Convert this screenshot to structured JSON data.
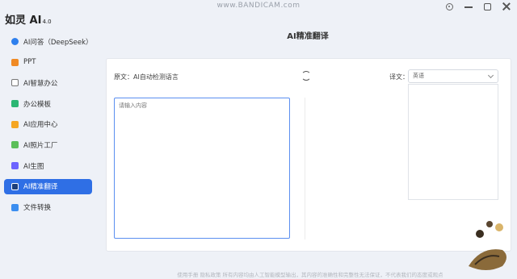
{
  "watermark": "www.BANDICAM.com",
  "app": {
    "name": "如灵 AI",
    "version": "4.0"
  },
  "sidebar": {
    "items": [
      {
        "label": "AI问答（DeepSeek）",
        "icon": "chat-icon",
        "color": "#2f80ed"
      },
      {
        "label": "PPT",
        "icon": "ppt-icon",
        "color": "#f08a24"
      },
      {
        "label": "AI智慧办公",
        "icon": "edit-icon",
        "color": "#777777"
      },
      {
        "label": "办公模板",
        "icon": "template-icon",
        "color": "#2bb673"
      },
      {
        "label": "AI应用中心",
        "icon": "app-center-icon",
        "color": "#f5a623"
      },
      {
        "label": "AI照片工厂",
        "icon": "photo-factory-icon",
        "color": "#5cbf5a"
      },
      {
        "label": "AI生图",
        "icon": "image-gen-icon",
        "color": "#6c63ff"
      },
      {
        "label": "AI精准翻译",
        "icon": "translate-icon",
        "color": "#ffffff",
        "active": true
      },
      {
        "label": "文件转换",
        "icon": "file-convert-icon",
        "color": "#3b8ef0"
      }
    ]
  },
  "main": {
    "title": "AI精准翻译",
    "source_label": "原文：AI自动检测语言",
    "target_label": "译文：",
    "target_language": "英语",
    "input_placeholder": "请输入内容"
  },
  "footer": "使用手册 隐私政策 所有内容均由人工智能模型输出，其内容的准确性和完整性无法保证，不代表我们的态度或观点"
}
